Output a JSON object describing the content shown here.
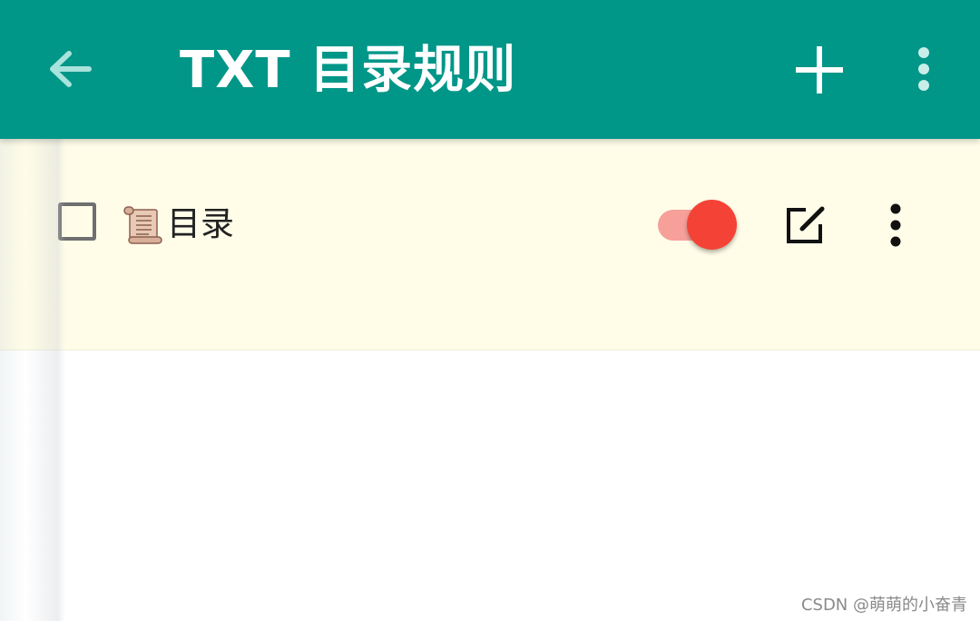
{
  "appbar": {
    "title": "TXT 目录规则",
    "background_color": "#009688",
    "back_icon": "arrow-back-icon",
    "add_icon": "plus-icon",
    "overflow_icon": "more-vert-icon"
  },
  "rules": [
    {
      "name": "目录",
      "icon": "scroll-icon",
      "checked": false,
      "enabled": true,
      "background_color": "#fffde8",
      "switch_color": "#f44336",
      "edit_icon": "edit-icon",
      "more_icon": "more-vert-icon"
    }
  ],
  "watermark": "CSDN @萌萌的小奋青"
}
